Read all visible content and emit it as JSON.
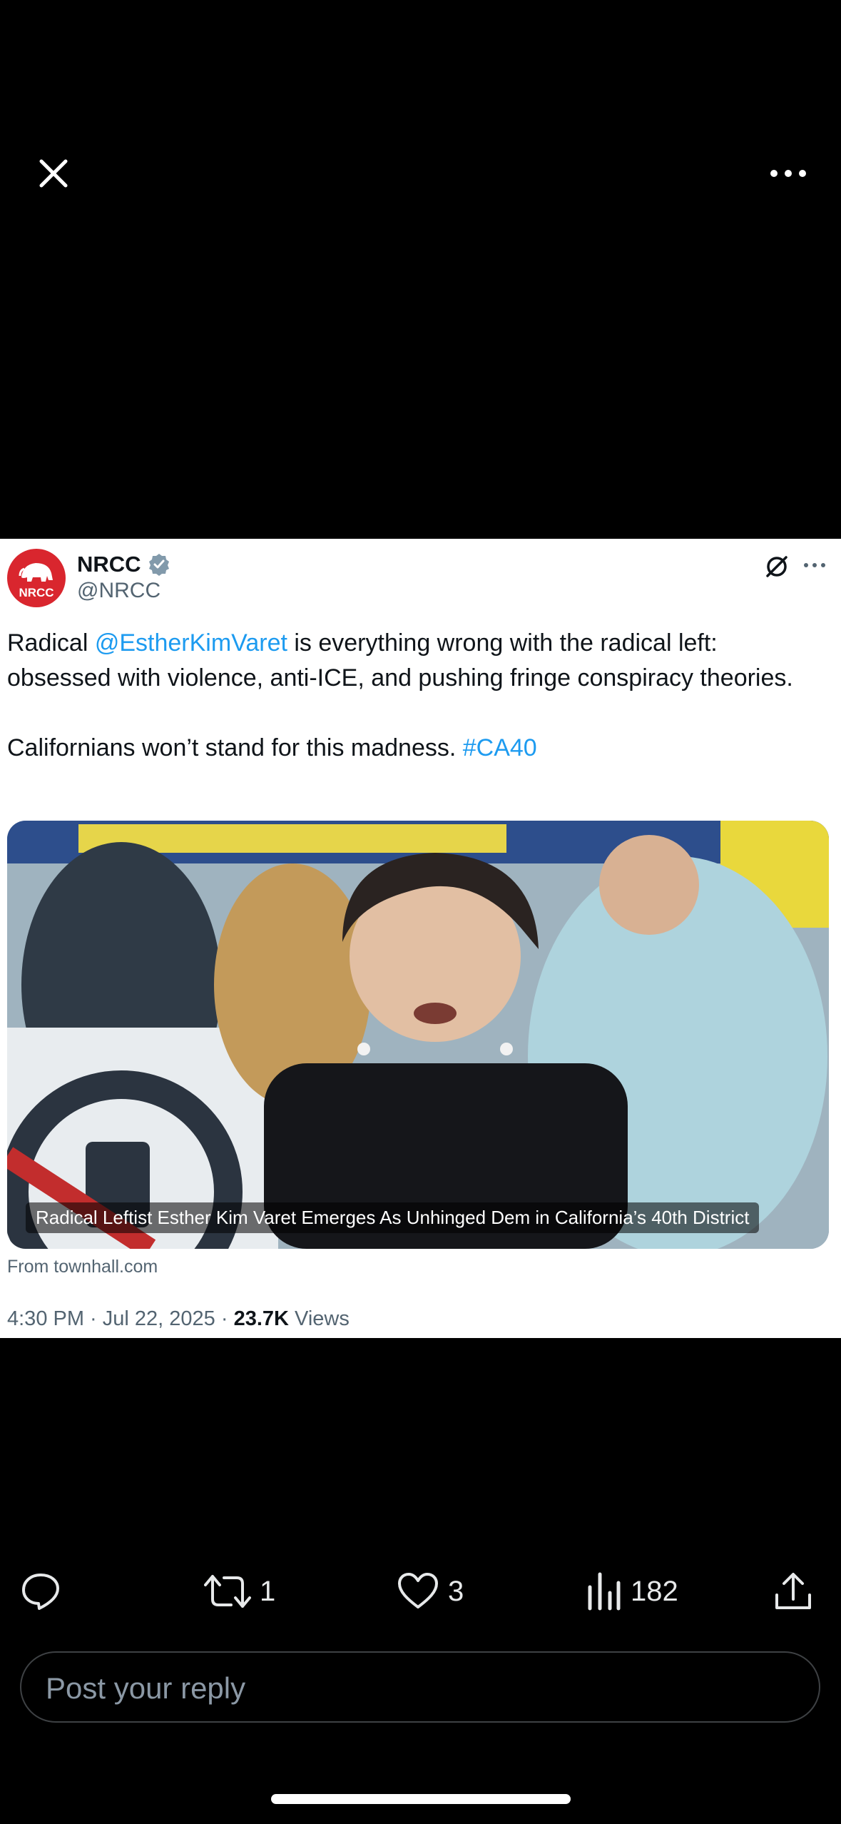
{
  "post": {
    "author_name": "NRCC",
    "author_handle": "@NRCC",
    "avatar_text": "NRCC",
    "text_part1": "Radical ",
    "mention": "@EstherKimVaret",
    "text_part2": " is everything wrong with the radical left: obsessed with violence, anti-ICE, and pushing fringe conspiracy theories.",
    "text_line2_part1": "Californians won’t stand for this madness. ",
    "hashtag": "#CA40",
    "media_caption": "Radical Leftist Esther Kim Varet Emerges As Unhinged Dem in California’s 40th District",
    "source": "From townhall.com",
    "time": "4:30 PM · Jul 22, 2025 · ",
    "views_count": "23.7K",
    "views_label": " Views"
  },
  "actions": {
    "retweets": "1",
    "likes": "3",
    "views": "182"
  },
  "reply": {
    "placeholder": "Post your reply"
  },
  "icons": [
    "close-icon",
    "more-icon",
    "verified-icon",
    "grok-icon",
    "reply-icon",
    "retweet-icon",
    "like-icon",
    "views-icon",
    "share-icon"
  ],
  "colors": {
    "link": "#1d9bf0",
    "brand": "#d9262e",
    "background": "#000000"
  }
}
